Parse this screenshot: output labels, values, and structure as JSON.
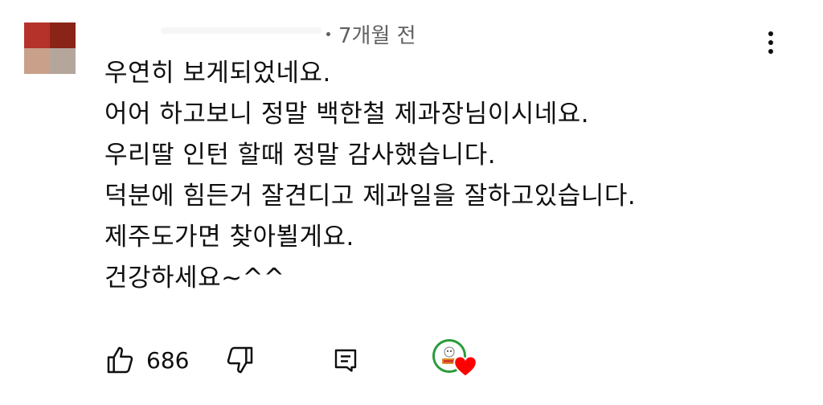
{
  "comment": {
    "author": {
      "avatar_colors": [
        "#b5322a",
        "#8a2418",
        "#c9a089",
        "#b5a69c"
      ]
    },
    "timestamp": "7개월 전",
    "lines": [
      "우연히 보게되었네요.",
      "어어  하고보니 정말 백한철 제과장님이시네요.",
      "우리딸 인턴 할때 정말 감사했습니다.",
      "덕분에  힘든거 잘견디고  제과일을 잘하고있습니다.",
      "제주도가면 찾아뵐게요.",
      "건강하세요~^^"
    ],
    "menu_icon": "more-vert-icon"
  },
  "actions": {
    "like_icon": "thumbs-up-icon",
    "like_count": "686",
    "dislike_icon": "thumbs-down-icon",
    "reply_icon": "reply-icon",
    "creator_heart": {
      "avatar_icon": "channel-avatar-icon",
      "heart_icon": "heart-icon",
      "heart_color": "#ff0000",
      "badge_color": "#2a9b3a"
    }
  }
}
